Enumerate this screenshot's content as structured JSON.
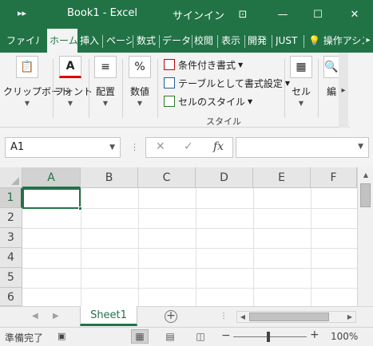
{
  "titlebar": {
    "qat_glyph": "▸▸",
    "title": "Book1  -  Excel",
    "signin": "サインイン",
    "ribbon_options_glyph": "⊡",
    "minimize_glyph": "—",
    "maximize_glyph": "☐",
    "close_glyph": "✕"
  },
  "tabs": [
    {
      "label": "ファイル",
      "active": false
    },
    {
      "label": "ホーム",
      "active": true
    },
    {
      "label": "挿入",
      "active": false
    },
    {
      "label": "ページ",
      "active": false
    },
    {
      "label": "数式",
      "active": false
    },
    {
      "label": "データ",
      "active": false
    },
    {
      "label": "校閲",
      "active": false
    },
    {
      "label": "表示",
      "active": false
    },
    {
      "label": "開発",
      "active": false
    },
    {
      "label": "JUST",
      "active": false
    }
  ],
  "tell_me": "操作アシスト",
  "ribbon": {
    "clipboard": "クリップボード",
    "font": "フォント",
    "alignment": "配置",
    "number": "数値",
    "styles": {
      "conditional": "条件付き書式",
      "table": "テーブルとして書式設定",
      "cell_styles": "セルのスタイル",
      "group_label": "スタイル"
    },
    "cells": "セル",
    "editing": "編"
  },
  "namebox": {
    "value": "A1"
  },
  "formula_bar": {
    "cancel": "✕",
    "enter": "✓",
    "fx": "fx",
    "value": ""
  },
  "columns": [
    "A",
    "B",
    "C",
    "D",
    "E",
    "F"
  ],
  "rows": [
    "1",
    "2",
    "3",
    "4",
    "5",
    "6"
  ],
  "sheets": [
    {
      "name": "Sheet1",
      "active": true
    }
  ],
  "status": {
    "ready": "準備完了",
    "zoom_minus": "−",
    "zoom_plus": "+",
    "zoom_level": "100%",
    "zoom_fraction": 0.5
  },
  "colors": {
    "accent": "#217346",
    "ribbon_bg": "#f3f3f3",
    "header_bg": "#e6e6e6"
  }
}
